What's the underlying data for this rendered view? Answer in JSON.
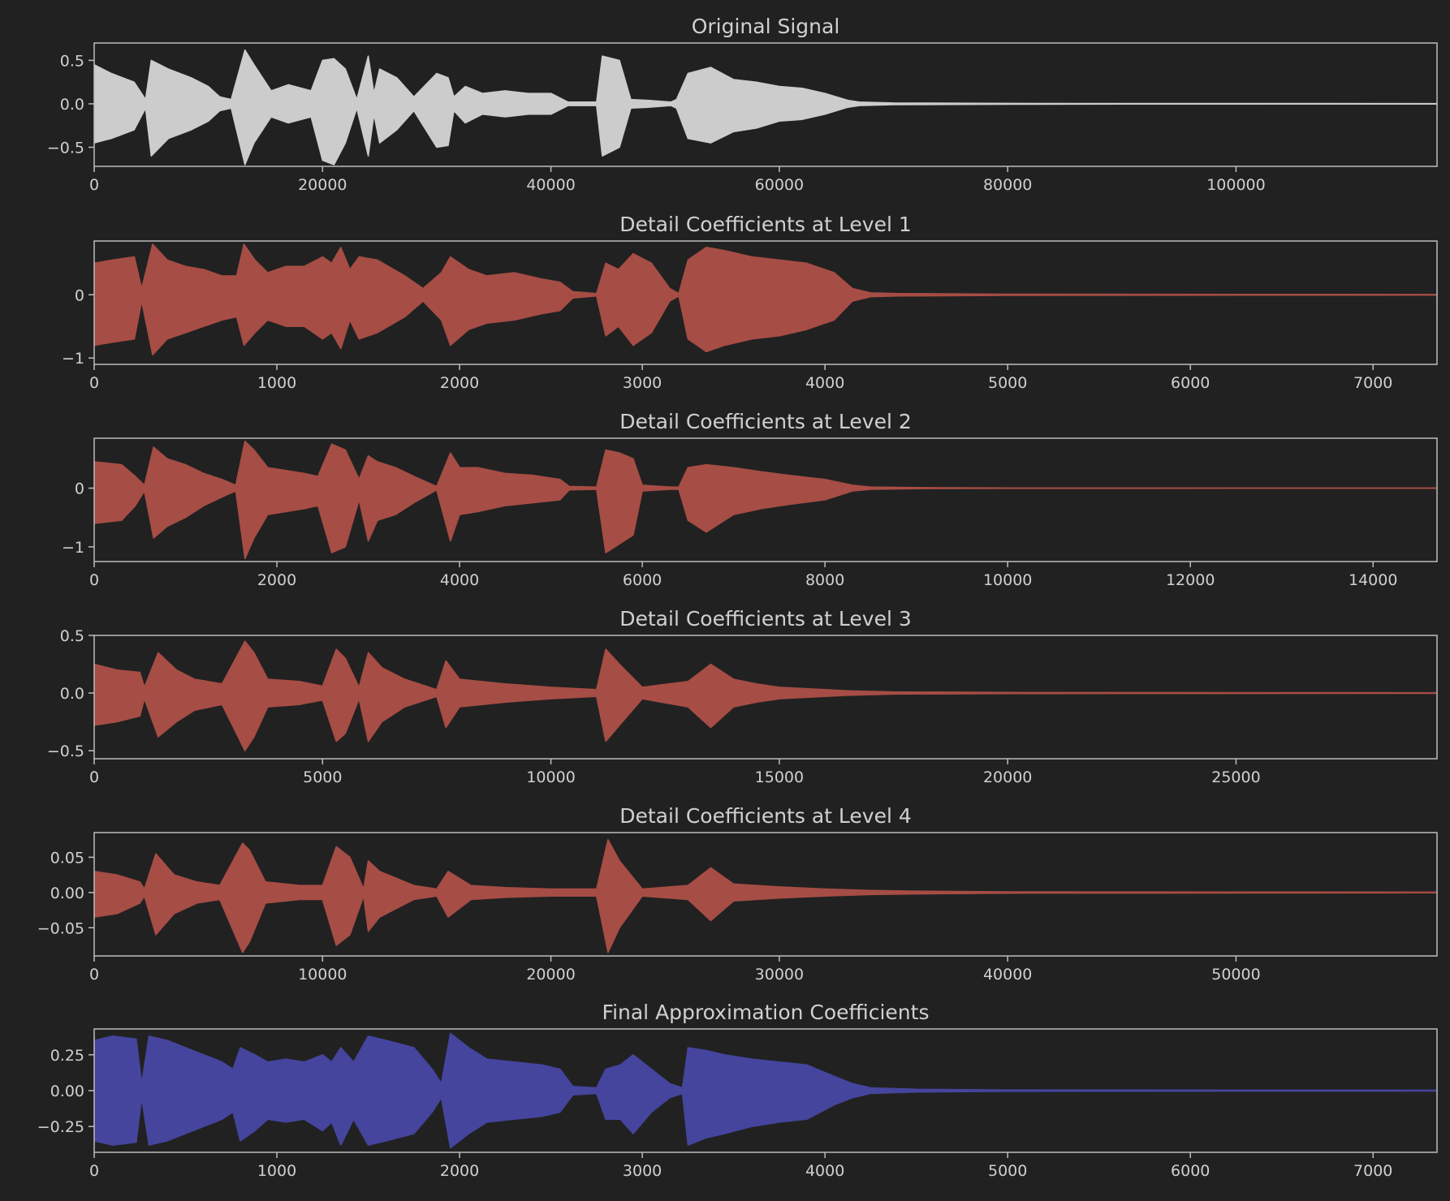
{
  "theme": {
    "background": "#212121",
    "axis_color": "#bdbdbd",
    "text_color": "#d0d0d0",
    "original_color": "#cccccc",
    "detail_color": "#a64d45",
    "approx_color": "#45459e"
  },
  "chart_data": [
    {
      "type": "area",
      "title": "Original Signal",
      "xlabel": "",
      "ylabel": "",
      "xlim": [
        0,
        117600
      ],
      "ylim": [
        -0.72,
        0.7
      ],
      "xticks": [
        0,
        20000,
        40000,
        60000,
        80000,
        100000
      ],
      "xtick_labels": [
        "0",
        "20000",
        "40000",
        "60000",
        "80000",
        "100000"
      ],
      "yticks": [
        -0.5,
        0.0,
        0.5
      ],
      "ytick_labels": [
        "−0.5",
        "0.0",
        "0.5"
      ],
      "grid": false,
      "color": "#cccccc",
      "envelope": {
        "x": [
          0,
          1500,
          3500,
          4500,
          5000,
          6500,
          8500,
          10000,
          11000,
          12000,
          13200,
          14000,
          15500,
          17000,
          19000,
          20000,
          21000,
          22000,
          23000,
          24000,
          24500,
          25000,
          26500,
          28000,
          30000,
          31000,
          31500,
          32500,
          34000,
          36000,
          38000,
          40000,
          41500,
          44000,
          44500,
          46000,
          47000,
          48500,
          50500,
          51000,
          52000,
          54000,
          56000,
          58000,
          60000,
          62000,
          64000,
          66000,
          67000,
          70000,
          80000,
          90000,
          117600
        ],
        "upper": [
          0.45,
          0.35,
          0.25,
          0.05,
          0.5,
          0.4,
          0.3,
          0.2,
          0.08,
          0.05,
          0.62,
          0.45,
          0.15,
          0.22,
          0.15,
          0.5,
          0.52,
          0.4,
          0.05,
          0.55,
          0.12,
          0.4,
          0.3,
          0.08,
          0.35,
          0.3,
          0.08,
          0.2,
          0.12,
          0.15,
          0.12,
          0.12,
          0.02,
          0.02,
          0.55,
          0.5,
          0.05,
          0.04,
          0.02,
          0.05,
          0.35,
          0.42,
          0.28,
          0.25,
          0.2,
          0.18,
          0.12,
          0.04,
          0.02,
          0.01,
          0.005,
          0.003,
          0.002
        ],
        "lower": [
          -0.45,
          -0.4,
          -0.3,
          -0.05,
          -0.6,
          -0.4,
          -0.3,
          -0.2,
          -0.08,
          -0.05,
          -0.7,
          -0.45,
          -0.15,
          -0.22,
          -0.15,
          -0.65,
          -0.7,
          -0.45,
          -0.05,
          -0.6,
          -0.12,
          -0.45,
          -0.3,
          -0.08,
          -0.5,
          -0.48,
          -0.08,
          -0.22,
          -0.12,
          -0.15,
          -0.12,
          -0.12,
          -0.02,
          -0.02,
          -0.6,
          -0.5,
          -0.05,
          -0.04,
          -0.02,
          -0.05,
          -0.4,
          -0.45,
          -0.32,
          -0.28,
          -0.2,
          -0.18,
          -0.12,
          -0.04,
          -0.02,
          -0.01,
          -0.005,
          -0.003,
          -0.002
        ]
      }
    },
    {
      "type": "area",
      "title": "Detail Coefficients at Level 1",
      "xlabel": "",
      "ylabel": "",
      "xlim": [
        0,
        7350
      ],
      "ylim": [
        -1.1,
        0.85
      ],
      "xticks": [
        0,
        1000,
        2000,
        3000,
        4000,
        5000,
        6000,
        7000
      ],
      "xtick_labels": [
        "0",
        "1000",
        "2000",
        "3000",
        "4000",
        "5000",
        "6000",
        "7000"
      ],
      "yticks": [
        -1,
        0
      ],
      "ytick_labels": [
        "−1",
        "0"
      ],
      "grid": false,
      "color": "#a64d45",
      "envelope": {
        "x": [
          0,
          100,
          220,
          260,
          320,
          400,
          500,
          600,
          700,
          780,
          820,
          880,
          950,
          1050,
          1150,
          1250,
          1300,
          1350,
          1400,
          1450,
          1550,
          1700,
          1800,
          1900,
          1950,
          2050,
          2150,
          2300,
          2450,
          2550,
          2620,
          2750,
          2800,
          2870,
          2950,
          3050,
          3150,
          3200,
          3250,
          3350,
          3450,
          3600,
          3750,
          3900,
          4050,
          4150,
          4250,
          4400,
          5000,
          7350
        ],
        "upper": [
          0.5,
          0.55,
          0.6,
          0.1,
          0.8,
          0.55,
          0.45,
          0.4,
          0.3,
          0.3,
          0.8,
          0.55,
          0.35,
          0.45,
          0.45,
          0.6,
          0.5,
          0.75,
          0.4,
          0.6,
          0.55,
          0.3,
          0.1,
          0.35,
          0.6,
          0.4,
          0.3,
          0.35,
          0.25,
          0.2,
          0.05,
          0.02,
          0.5,
          0.4,
          0.65,
          0.5,
          0.1,
          0.02,
          0.55,
          0.75,
          0.7,
          0.6,
          0.55,
          0.5,
          0.35,
          0.1,
          0.03,
          0.02,
          0.01,
          0.005
        ],
        "lower": [
          -0.8,
          -0.75,
          -0.7,
          -0.1,
          -0.95,
          -0.7,
          -0.6,
          -0.5,
          -0.4,
          -0.35,
          -0.8,
          -0.6,
          -0.4,
          -0.5,
          -0.5,
          -0.7,
          -0.6,
          -0.85,
          -0.4,
          -0.7,
          -0.6,
          -0.35,
          -0.1,
          -0.4,
          -0.8,
          -0.55,
          -0.45,
          -0.4,
          -0.3,
          -0.25,
          -0.05,
          -0.02,
          -0.65,
          -0.5,
          -0.8,
          -0.6,
          -0.1,
          -0.02,
          -0.7,
          -0.9,
          -0.8,
          -0.7,
          -0.65,
          -0.55,
          -0.4,
          -0.1,
          -0.03,
          -0.02,
          -0.01,
          -0.005
        ]
      }
    },
    {
      "type": "area",
      "title": "Detail Coefficients at Level 2",
      "xlabel": "",
      "ylabel": "",
      "xlim": [
        0,
        14700
      ],
      "ylim": [
        -1.25,
        0.85
      ],
      "xticks": [
        0,
        2000,
        4000,
        6000,
        8000,
        10000,
        12000,
        14000
      ],
      "xtick_labels": [
        "0",
        "2000",
        "4000",
        "6000",
        "8000",
        "10000",
        "12000",
        "14000"
      ],
      "yticks": [
        -1,
        0
      ],
      "ytick_labels": [
        "−1",
        "0"
      ],
      "grid": false,
      "color": "#a64d45",
      "envelope": {
        "x": [
          0,
          300,
          450,
          550,
          650,
          800,
          1000,
          1200,
          1400,
          1550,
          1650,
          1750,
          1900,
          2100,
          2300,
          2450,
          2600,
          2750,
          2900,
          3000,
          3100,
          3300,
          3500,
          3750,
          3900,
          4000,
          4200,
          4500,
          4800,
          5100,
          5200,
          5500,
          5600,
          5750,
          5900,
          6000,
          6300,
          6400,
          6500,
          6700,
          7000,
          7300,
          7600,
          8000,
          8300,
          8500,
          9000,
          10000,
          14700
        ],
        "upper": [
          0.45,
          0.4,
          0.2,
          0.05,
          0.7,
          0.5,
          0.4,
          0.25,
          0.15,
          0.05,
          0.8,
          0.65,
          0.35,
          0.3,
          0.25,
          0.2,
          0.75,
          0.65,
          0.15,
          0.55,
          0.45,
          0.35,
          0.2,
          0.03,
          0.6,
          0.35,
          0.35,
          0.25,
          0.22,
          0.15,
          0.03,
          0.02,
          0.65,
          0.6,
          0.5,
          0.05,
          0.02,
          0.02,
          0.35,
          0.4,
          0.35,
          0.28,
          0.22,
          0.15,
          0.05,
          0.02,
          0.01,
          0.005,
          0.003
        ],
        "lower": [
          -0.6,
          -0.55,
          -0.3,
          -0.05,
          -0.85,
          -0.65,
          -0.5,
          -0.3,
          -0.15,
          -0.05,
          -1.2,
          -0.85,
          -0.45,
          -0.4,
          -0.35,
          -0.3,
          -1.1,
          -1.0,
          -0.2,
          -0.9,
          -0.55,
          -0.45,
          -0.25,
          -0.03,
          -0.9,
          -0.45,
          -0.4,
          -0.3,
          -0.25,
          -0.2,
          -0.03,
          -0.02,
          -1.1,
          -0.95,
          -0.8,
          -0.05,
          -0.02,
          -0.02,
          -0.55,
          -0.75,
          -0.45,
          -0.35,
          -0.28,
          -0.2,
          -0.05,
          -0.02,
          -0.01,
          -0.005,
          -0.003
        ]
      }
    },
    {
      "type": "area",
      "title": "Detail Coefficients at Level 3",
      "xlabel": "",
      "ylabel": "",
      "xlim": [
        0,
        29400
      ],
      "ylim": [
        -0.57,
        0.5
      ],
      "xticks": [
        0,
        5000,
        10000,
        15000,
        20000,
        25000
      ],
      "xtick_labels": [
        "0",
        "5000",
        "10000",
        "15000",
        "20000",
        "25000"
      ],
      "yticks": [
        -0.5,
        0.0,
        0.5
      ],
      "ytick_labels": [
        "−0.5",
        "0.0",
        "0.5"
      ],
      "grid": false,
      "color": "#a64d45",
      "envelope": {
        "x": [
          0,
          500,
          1000,
          1100,
          1400,
          1800,
          2200,
          2800,
          3300,
          3500,
          3800,
          4500,
          5000,
          5300,
          5500,
          5800,
          6000,
          6300,
          6800,
          7500,
          7700,
          8000,
          9000,
          10000,
          11000,
          11200,
          11500,
          12000,
          13000,
          13500,
          14000,
          14500,
          15000,
          16000,
          16500,
          17500,
          20000,
          29400
        ],
        "upper": [
          0.25,
          0.2,
          0.18,
          0.05,
          0.35,
          0.2,
          0.12,
          0.08,
          0.45,
          0.35,
          0.12,
          0.1,
          0.06,
          0.38,
          0.3,
          0.05,
          0.35,
          0.22,
          0.12,
          0.03,
          0.28,
          0.12,
          0.08,
          0.05,
          0.03,
          0.38,
          0.25,
          0.05,
          0.1,
          0.25,
          0.12,
          0.08,
          0.05,
          0.03,
          0.02,
          0.01,
          0.005,
          0.003
        ],
        "lower": [
          -0.28,
          -0.25,
          -0.2,
          -0.05,
          -0.38,
          -0.25,
          -0.15,
          -0.1,
          -0.5,
          -0.38,
          -0.12,
          -0.1,
          -0.06,
          -0.42,
          -0.35,
          -0.05,
          -0.42,
          -0.25,
          -0.12,
          -0.03,
          -0.3,
          -0.12,
          -0.08,
          -0.05,
          -0.03,
          -0.42,
          -0.28,
          -0.05,
          -0.12,
          -0.3,
          -0.12,
          -0.08,
          -0.05,
          -0.03,
          -0.02,
          -0.01,
          -0.005,
          -0.003
        ]
      }
    },
    {
      "type": "area",
      "title": "Detail Coefficients at Level 4",
      "xlabel": "",
      "ylabel": "",
      "xlim": [
        0,
        58800
      ],
      "ylim": [
        -0.09,
        0.085
      ],
      "xticks": [
        0,
        10000,
        20000,
        30000,
        40000,
        50000
      ],
      "xtick_labels": [
        "0",
        "10000",
        "20000",
        "30000",
        "40000",
        "50000"
      ],
      "yticks": [
        -0.05,
        0.0,
        0.05
      ],
      "ytick_labels": [
        "−0.05",
        "0.00",
        "0.05"
      ],
      "grid": false,
      "color": "#a64d45",
      "envelope": {
        "x": [
          0,
          1000,
          2000,
          2200,
          2700,
          3500,
          4500,
          5500,
          6500,
          6800,
          7500,
          9000,
          10000,
          10600,
          11200,
          11800,
          12000,
          12500,
          14000,
          15000,
          15500,
          16500,
          18000,
          20000,
          22000,
          22500,
          23000,
          24000,
          26000,
          27000,
          28000,
          30000,
          32000,
          34000,
          36000,
          40000,
          58800
        ],
        "upper": [
          0.03,
          0.025,
          0.015,
          0.005,
          0.055,
          0.025,
          0.015,
          0.01,
          0.07,
          0.06,
          0.015,
          0.01,
          0.01,
          0.065,
          0.05,
          0.005,
          0.045,
          0.03,
          0.01,
          0.005,
          0.03,
          0.01,
          0.007,
          0.005,
          0.005,
          0.075,
          0.045,
          0.005,
          0.01,
          0.035,
          0.012,
          0.008,
          0.005,
          0.003,
          0.002,
          0.001,
          0.0005
        ],
        "lower": [
          -0.035,
          -0.03,
          -0.015,
          -0.005,
          -0.06,
          -0.03,
          -0.015,
          -0.01,
          -0.085,
          -0.07,
          -0.015,
          -0.01,
          -0.01,
          -0.075,
          -0.06,
          -0.005,
          -0.055,
          -0.035,
          -0.01,
          -0.005,
          -0.035,
          -0.01,
          -0.007,
          -0.005,
          -0.005,
          -0.085,
          -0.05,
          -0.005,
          -0.01,
          -0.04,
          -0.012,
          -0.008,
          -0.005,
          -0.003,
          -0.002,
          -0.001,
          -0.0005
        ]
      }
    },
    {
      "type": "area",
      "title": "Final Approximation Coefficients",
      "xlabel": "",
      "ylabel": "",
      "xlim": [
        0,
        7350
      ],
      "ylim": [
        -0.43,
        0.43
      ],
      "xticks": [
        0,
        1000,
        2000,
        3000,
        4000,
        5000,
        6000,
        7000
      ],
      "xtick_labels": [
        "0",
        "1000",
        "2000",
        "3000",
        "4000",
        "5000",
        "6000",
        "7000"
      ],
      "yticks": [
        -0.25,
        0.0,
        0.25
      ],
      "ytick_labels": [
        "−0.25",
        "0.00",
        "0.25"
      ],
      "grid": false,
      "color": "#45459e",
      "envelope": {
        "x": [
          0,
          100,
          230,
          260,
          300,
          400,
          500,
          600,
          700,
          760,
          800,
          880,
          950,
          1050,
          1150,
          1250,
          1300,
          1350,
          1420,
          1500,
          1600,
          1750,
          1850,
          1900,
          1950,
          2050,
          2150,
          2300,
          2450,
          2550,
          2620,
          2750,
          2800,
          2880,
          2950,
          3050,
          3150,
          3220,
          3250,
          3350,
          3450,
          3600,
          3750,
          3900,
          4050,
          4150,
          4250,
          4500,
          5000,
          7350
        ],
        "upper": [
          0.35,
          0.38,
          0.36,
          0.05,
          0.38,
          0.35,
          0.3,
          0.25,
          0.2,
          0.15,
          0.3,
          0.25,
          0.2,
          0.22,
          0.2,
          0.25,
          0.2,
          0.3,
          0.2,
          0.38,
          0.35,
          0.3,
          0.15,
          0.05,
          0.4,
          0.3,
          0.22,
          0.2,
          0.18,
          0.15,
          0.03,
          0.02,
          0.15,
          0.18,
          0.25,
          0.15,
          0.05,
          0.02,
          0.3,
          0.28,
          0.25,
          0.22,
          0.2,
          0.18,
          0.1,
          0.05,
          0.02,
          0.01,
          0.005,
          0.003
        ],
        "lower": [
          -0.35,
          -0.38,
          -0.36,
          -0.05,
          -0.38,
          -0.35,
          -0.3,
          -0.25,
          -0.2,
          -0.15,
          -0.35,
          -0.28,
          -0.2,
          -0.22,
          -0.2,
          -0.28,
          -0.22,
          -0.38,
          -0.2,
          -0.38,
          -0.35,
          -0.3,
          -0.15,
          -0.05,
          -0.4,
          -0.3,
          -0.22,
          -0.2,
          -0.18,
          -0.15,
          -0.03,
          -0.02,
          -0.2,
          -0.2,
          -0.3,
          -0.15,
          -0.05,
          -0.02,
          -0.38,
          -0.33,
          -0.3,
          -0.25,
          -0.22,
          -0.2,
          -0.1,
          -0.05,
          -0.02,
          -0.01,
          -0.005,
          -0.003
        ]
      }
    }
  ]
}
